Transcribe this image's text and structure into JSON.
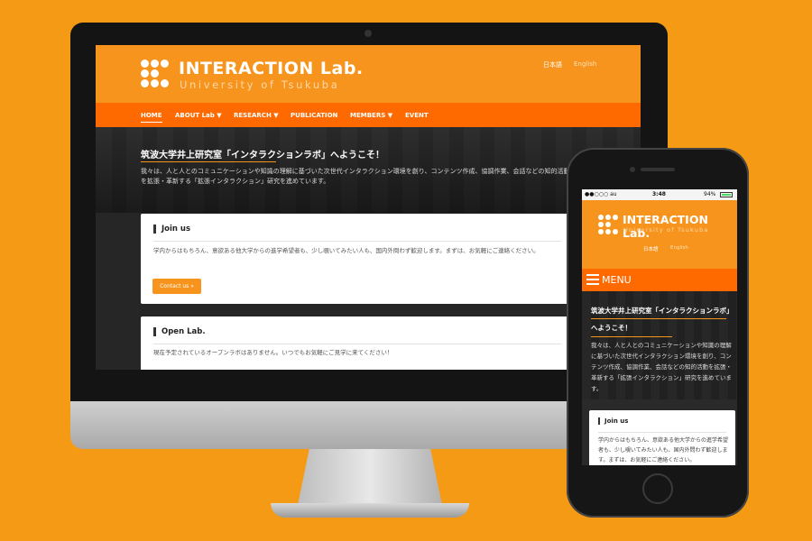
{
  "desktop": {
    "logo": {
      "title": "INTERACTION Lab.",
      "subtitle": "University of Tsukuba"
    },
    "languages": [
      "日本語",
      "English"
    ],
    "nav": [
      {
        "label": "HOME"
      },
      {
        "label": "ABOUT Lab ▼"
      },
      {
        "label": "RESEARCH ▼"
      },
      {
        "label": "PUBLICATION"
      },
      {
        "label": "MEMBERS ▼"
      },
      {
        "label": "EVENT"
      }
    ],
    "hero": {
      "title": "筑波大学井上研究室「インタラクションラボ」へようこそ！",
      "text": "我々は、人と人とのコミュニケーションや知識の理解に基づいた次世代インタラクション環境を創り、コンテンツ作成、協調作業、会話などの知的活動を拡張・革新する「拡張インタラクション」研究を進めています。"
    },
    "join": {
      "title": "Join us",
      "text": "学内からはもちろん、意欲ある他大学からの進学希望者も、少し覗いてみたい人も、国内外問わず歓迎します。まずは、お気軽にご連絡ください。",
      "button": "Contact us »"
    },
    "openlab": {
      "title": "Open Lab.",
      "text": "現在予定されているオープンラボはありません。いつでもお気軽にご見学に来てください！"
    }
  },
  "phone": {
    "status": {
      "carrier": "●●○○○ au ",
      "time": "3:48",
      "battery": "94%"
    },
    "logo": {
      "title": "INTERACTION Lab.",
      "subtitle": "University of Tsukuba"
    },
    "languages": [
      "日本語",
      "English"
    ],
    "menu_label": "MENU",
    "hero": {
      "title": "筑波大学井上研究室「インタラクションラボ」へようこそ！",
      "text": "我々は、人と人とのコミュニケーションや知識の理解に基づいた次世代インタラクション環境を創り、コンテンツ作成、協調作業、会話などの知的活動を拡張・革新する「拡張インタラクション」研究を進めています。"
    },
    "join": {
      "title": "Join us",
      "text": "学内からはもちろん、意欲ある他大学からの進学希望者も、少し覗いてみたい人も、国内外問わず歓迎します。まずは、お気軽にご連絡ください。"
    }
  },
  "colors": {
    "background": "#f59a14",
    "brand": "#f7941d",
    "nav": "#ff6a00"
  }
}
